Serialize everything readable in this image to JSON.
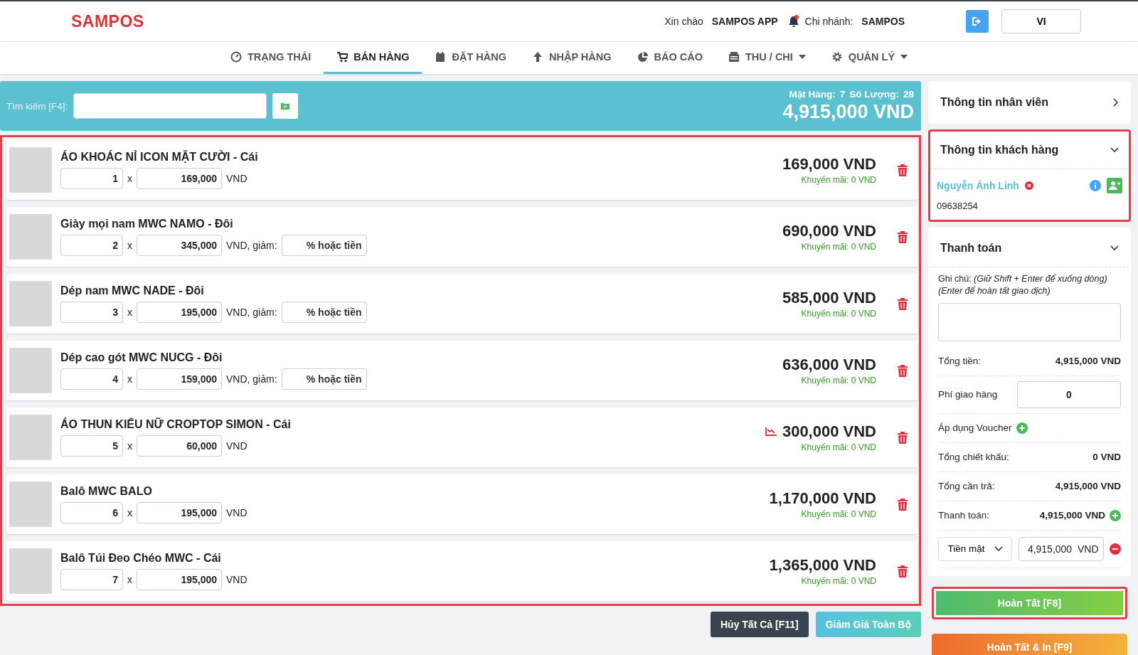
{
  "header": {
    "logo": "SAMPOS",
    "greeting": "Xin chào",
    "user": "SAMPOS APP",
    "branch_label": "Chi nhánh:",
    "branch": "SAMPOS",
    "language": "VI"
  },
  "tabs": [
    {
      "label": "TRẠNG THÁI",
      "selected": false,
      "has_dropdown": false
    },
    {
      "label": "BÁN HÀNG",
      "selected": true,
      "has_dropdown": false
    },
    {
      "label": "ĐẶT HÀNG",
      "selected": false,
      "has_dropdown": false
    },
    {
      "label": "NHẬP HÀNG",
      "selected": false,
      "has_dropdown": false
    },
    {
      "label": "BÁO CÁO",
      "selected": false,
      "has_dropdown": false
    },
    {
      "label": "THU / CHI",
      "selected": false,
      "has_dropdown": true
    },
    {
      "label": "QUẢN LÝ",
      "selected": false,
      "has_dropdown": true
    }
  ],
  "search": {
    "label": "Tìm kiếm [F4]:",
    "items_label": "Mặt Hàng:",
    "items_count": "7",
    "quantity_label": "Số Lượng:",
    "quantity_count": "28",
    "total": "4,915,000 VND"
  },
  "cart": {
    "highlighted": true,
    "items": [
      {
        "kind": "plain",
        "name": "ÁO KHOÁC NỈ ICON MẶT CƯỜI - Cái",
        "qty": "1",
        "times_sign": "x",
        "price": "169,000",
        "currency": "VND",
        "total": "169,000 VND",
        "promo": "Khuyến mãi: 0 VND",
        "price_changed": false
      },
      {
        "kind": "discount",
        "name": "Giày mọi nam MWC NAMO - Đôi",
        "qty": "2",
        "times_sign": "x",
        "price": "345,000",
        "currency": "VND, giảm:",
        "discount_placeholder": "% hoặc tiền",
        "total": "690,000 VND",
        "promo": "Khuyến mãi: 0 VND",
        "price_changed": false
      },
      {
        "kind": "discount",
        "name": "Dép nam MWC NADE - Đôi",
        "qty": "3",
        "times_sign": "x",
        "price": "195,000",
        "currency": "VND, giảm:",
        "discount_placeholder": "% hoặc tiền",
        "total": "585,000 VND",
        "promo": "Khuyến mãi: 0 VND",
        "price_changed": false
      },
      {
        "kind": "discount",
        "name": "Dép cao gót MWC NUCG - Đôi",
        "qty": "4",
        "times_sign": "x",
        "price": "159,000",
        "currency": "VND, giảm:",
        "discount_placeholder": "% hoặc tiền",
        "total": "636,000 VND",
        "promo": "Khuyến mãi: 0 VND",
        "price_changed": false
      },
      {
        "kind": "plain",
        "name": "ÁO THUN KIỂU NỮ CROPTOP SIMON - Cái",
        "qty": "5",
        "times_sign": "x",
        "price": "60,000",
        "currency": "VND",
        "total": "300,000 VND",
        "promo": "Khuyến mãi: 0 VND",
        "price_changed": true
      },
      {
        "kind": "plain",
        "name": "Balô MWC BALO",
        "qty": "6",
        "times_sign": "x",
        "price": "195,000",
        "currency": "VND",
        "total": "1,170,000 VND",
        "promo": "Khuyến mãi: 0 VND",
        "price_changed": false
      },
      {
        "kind": "plain",
        "name": "Balô Túi Đeo Chéo MWC - Cái",
        "qty": "7",
        "times_sign": "x",
        "price": "195,000",
        "currency": "VND",
        "total": "1,365,000 VND",
        "promo": "Khuyến mãi: 0 VND",
        "price_changed": false
      }
    ]
  },
  "cart_actions": [
    {
      "label": "Hủy Tất Cả [F11]",
      "kind": "dark"
    },
    {
      "label": "Giảm Giá Toàn Bộ",
      "kind": "info"
    }
  ],
  "employee": {
    "title": "Thông tin nhân viên",
    "expanded": false
  },
  "customer": {
    "title": "Thông tin khách hàng",
    "expanded": true,
    "highlighted": true,
    "name": "Nguyễn Ánh Linh",
    "phone": "09638254"
  },
  "payment": {
    "title": "Thanh toán",
    "expanded": true,
    "note_label": "Ghi chú: *(Giữ Shift + Enter để xuống dòng) (Enter để hoàn tất giao dịch)*",
    "rows": [
      {
        "kind": "amount",
        "label": "Tổng tiền:",
        "value": "4,915,000 VND"
      },
      {
        "kind": "input",
        "label": "Phí giao hàng",
        "value": "0"
      },
      {
        "kind": "voucher",
        "label": "Áp dụng Voucher"
      },
      {
        "kind": "amount",
        "label": "Tổng chiết khấu:",
        "value": "0 VND"
      },
      {
        "kind": "amount",
        "label": "Tổng cần trả:",
        "value": "4,915,000 VND"
      },
      {
        "kind": "payment",
        "label": "Thanh toán:",
        "value": "4,915,000 VND"
      },
      {
        "kind": "method",
        "label": "Tiền mặt",
        "value": "4,915,000  VND"
      }
    ]
  },
  "actions": [
    {
      "label": "Hoàn Tất [F8]",
      "kind": "complete",
      "highlighted": true
    },
    {
      "label": "Hoàn Tất & In [F9]",
      "kind": "print",
      "highlighted": false
    }
  ]
}
